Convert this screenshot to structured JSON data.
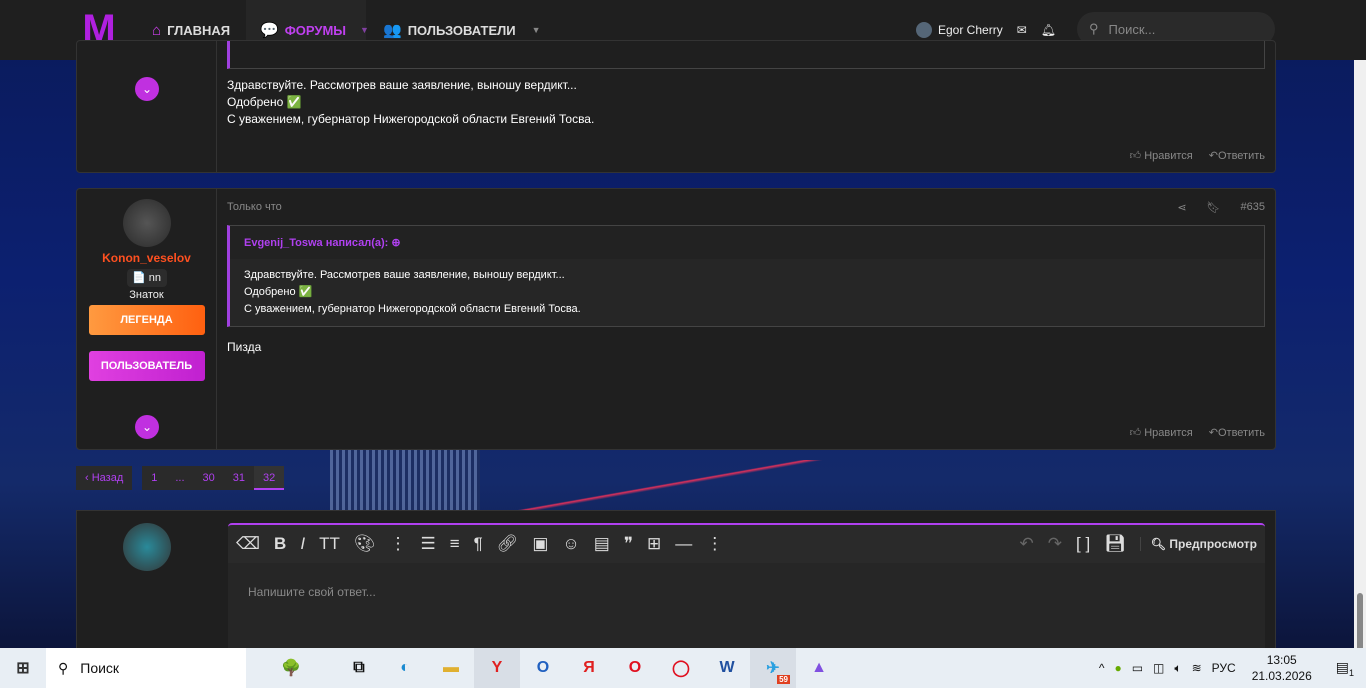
{
  "nav": {
    "logo": "M",
    "home": "ГЛАВНАЯ",
    "forums": "ФОРУМЫ",
    "members": "ПОЛЬЗОВАТЕЛИ",
    "username": "Egor Cherry",
    "search_placeholder": "Поиск..."
  },
  "prev_post": {
    "lines": [
      "Здравствуйте. Рассмотрев ваше заявление, выношу вердикт...",
      "Одобрено ✅",
      "С уважением, губернатор Нижегородской области Евгений Тосва."
    ],
    "like": "Нравится",
    "reply": "Ответить"
  },
  "post": {
    "time": "Только что",
    "number": "#635",
    "author": "Konon_veselov",
    "tag": "nn",
    "title": "Знаток",
    "badges": [
      "ЛЕГЕНДА",
      "ПОЛЬЗОВАТЕЛЬ"
    ],
    "quote_author": "Evgenij_Toswa написал(а):",
    "quote_lines": [
      "Здравствуйте. Рассмотрев ваше заявление, выношу вердикт...",
      "Одобрено ✅",
      "С уважением, губернатор Нижегородской области Евгений Тосва."
    ],
    "body": "Пизда",
    "like": "Нравится",
    "reply": "Ответить"
  },
  "pager": {
    "prev": "‹ Назад",
    "pages": [
      "1",
      "...",
      "30",
      "31",
      "32"
    ],
    "current": "32"
  },
  "editor": {
    "placeholder": "Напишите свой ответ...",
    "preview": "Предпросмотр"
  },
  "taskbar": {
    "search": "Поиск",
    "lang": "РУС",
    "time": "13:05",
    "date": "21.03.2026",
    "notifications": "1",
    "telegram_badge": "59"
  }
}
